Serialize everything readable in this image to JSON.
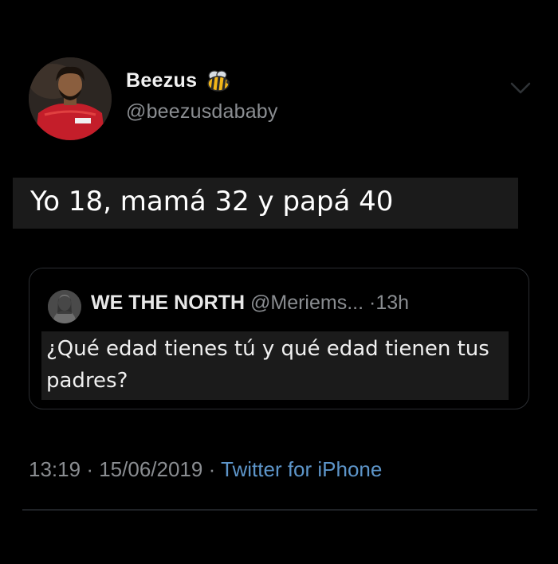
{
  "tweet": {
    "author": {
      "display_name": "Beezus",
      "handle": "@beezusdababy",
      "badge_icon": "bee-emoji-icon"
    },
    "menu_icon": "chevron-down-icon",
    "text": "Yo 18, mamá 32 y papá 40",
    "quoted": {
      "display_name": "WE THE NORTH",
      "handle": "@Meriems...",
      "separator": "·",
      "time_ago": "13h",
      "text": "¿Qué edad tienes tú y qué edad tienen tus padres?"
    },
    "meta": {
      "time": "13:19",
      "separator1": "·",
      "date": "15/06/2019",
      "separator2": "·",
      "source": "Twitter for iPhone"
    }
  },
  "colors": {
    "background": "#000000",
    "text_primary": "#ffffff",
    "text_secondary": "#8a8d91",
    "link": "#5d95c9",
    "text_highlight_bg": "#1b1b1b",
    "border": "#2a2d31"
  }
}
